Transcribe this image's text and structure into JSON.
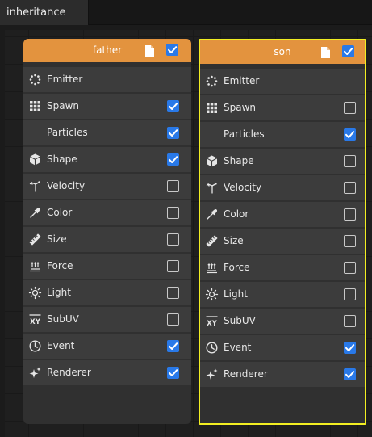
{
  "tab": {
    "title": "inheritance"
  },
  "colors": {
    "header": "#e3933e",
    "checkbox_on": "#2979e8",
    "selection": "#f2ee22"
  },
  "nodes": [
    {
      "title": "father",
      "enabled": true,
      "selected": false,
      "rows": [
        {
          "label": "Emitter",
          "icon": "emitter-icon",
          "checkbox": null
        },
        {
          "label": "Spawn",
          "icon": "grid-icon",
          "checkbox": true
        },
        {
          "label": "Particles",
          "icon": null,
          "checkbox": true
        },
        {
          "label": "Shape",
          "icon": "cube-icon",
          "checkbox": true
        },
        {
          "label": "Velocity",
          "icon": "velocity-icon",
          "checkbox": false
        },
        {
          "label": "Color",
          "icon": "eyedropper-icon",
          "checkbox": false
        },
        {
          "label": "Size",
          "icon": "ruler-icon",
          "checkbox": false
        },
        {
          "label": "Force",
          "icon": "force-icon",
          "checkbox": false
        },
        {
          "label": "Light",
          "icon": "sun-icon",
          "checkbox": false
        },
        {
          "label": "SubUV",
          "icon": "subuv-icon",
          "checkbox": false
        },
        {
          "label": "Event",
          "icon": "clock-icon",
          "checkbox": true
        },
        {
          "label": "Renderer",
          "icon": "sparkle-icon",
          "checkbox": true
        }
      ]
    },
    {
      "title": "son",
      "enabled": true,
      "selected": true,
      "rows": [
        {
          "label": "Emitter",
          "icon": "emitter-icon",
          "checkbox": null
        },
        {
          "label": "Spawn",
          "icon": "grid-icon",
          "checkbox": false
        },
        {
          "label": "Particles",
          "icon": null,
          "checkbox": true
        },
        {
          "label": "Shape",
          "icon": "cube-icon",
          "checkbox": false
        },
        {
          "label": "Velocity",
          "icon": "velocity-icon",
          "checkbox": false
        },
        {
          "label": "Color",
          "icon": "eyedropper-icon",
          "checkbox": false
        },
        {
          "label": "Size",
          "icon": "ruler-icon",
          "checkbox": false
        },
        {
          "label": "Force",
          "icon": "force-icon",
          "checkbox": false
        },
        {
          "label": "Light",
          "icon": "sun-icon",
          "checkbox": false
        },
        {
          "label": "SubUV",
          "icon": "subuv-icon",
          "checkbox": false
        },
        {
          "label": "Event",
          "icon": "clock-icon",
          "checkbox": true
        },
        {
          "label": "Renderer",
          "icon": "sparkle-icon",
          "checkbox": true
        }
      ]
    }
  ]
}
